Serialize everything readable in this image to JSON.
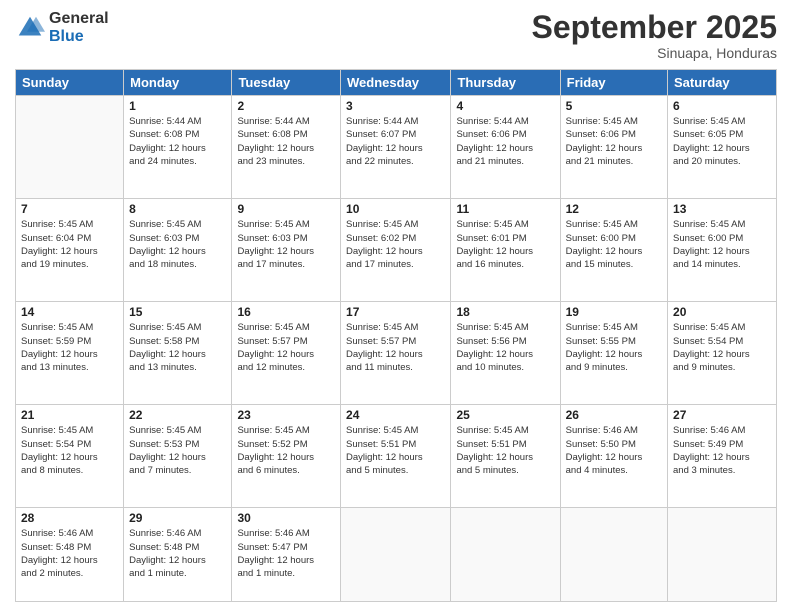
{
  "header": {
    "logo_general": "General",
    "logo_blue": "Blue",
    "month_title": "September 2025",
    "location": "Sinuapa, Honduras"
  },
  "days_of_week": [
    "Sunday",
    "Monday",
    "Tuesday",
    "Wednesday",
    "Thursday",
    "Friday",
    "Saturday"
  ],
  "weeks": [
    [
      {
        "day": "",
        "info": ""
      },
      {
        "day": "1",
        "info": "Sunrise: 5:44 AM\nSunset: 6:08 PM\nDaylight: 12 hours\nand 24 minutes."
      },
      {
        "day": "2",
        "info": "Sunrise: 5:44 AM\nSunset: 6:08 PM\nDaylight: 12 hours\nand 23 minutes."
      },
      {
        "day": "3",
        "info": "Sunrise: 5:44 AM\nSunset: 6:07 PM\nDaylight: 12 hours\nand 22 minutes."
      },
      {
        "day": "4",
        "info": "Sunrise: 5:44 AM\nSunset: 6:06 PM\nDaylight: 12 hours\nand 21 minutes."
      },
      {
        "day": "5",
        "info": "Sunrise: 5:45 AM\nSunset: 6:06 PM\nDaylight: 12 hours\nand 21 minutes."
      },
      {
        "day": "6",
        "info": "Sunrise: 5:45 AM\nSunset: 6:05 PM\nDaylight: 12 hours\nand 20 minutes."
      }
    ],
    [
      {
        "day": "7",
        "info": "Sunrise: 5:45 AM\nSunset: 6:04 PM\nDaylight: 12 hours\nand 19 minutes."
      },
      {
        "day": "8",
        "info": "Sunrise: 5:45 AM\nSunset: 6:03 PM\nDaylight: 12 hours\nand 18 minutes."
      },
      {
        "day": "9",
        "info": "Sunrise: 5:45 AM\nSunset: 6:03 PM\nDaylight: 12 hours\nand 17 minutes."
      },
      {
        "day": "10",
        "info": "Sunrise: 5:45 AM\nSunset: 6:02 PM\nDaylight: 12 hours\nand 17 minutes."
      },
      {
        "day": "11",
        "info": "Sunrise: 5:45 AM\nSunset: 6:01 PM\nDaylight: 12 hours\nand 16 minutes."
      },
      {
        "day": "12",
        "info": "Sunrise: 5:45 AM\nSunset: 6:00 PM\nDaylight: 12 hours\nand 15 minutes."
      },
      {
        "day": "13",
        "info": "Sunrise: 5:45 AM\nSunset: 6:00 PM\nDaylight: 12 hours\nand 14 minutes."
      }
    ],
    [
      {
        "day": "14",
        "info": "Sunrise: 5:45 AM\nSunset: 5:59 PM\nDaylight: 12 hours\nand 13 minutes."
      },
      {
        "day": "15",
        "info": "Sunrise: 5:45 AM\nSunset: 5:58 PM\nDaylight: 12 hours\nand 13 minutes."
      },
      {
        "day": "16",
        "info": "Sunrise: 5:45 AM\nSunset: 5:57 PM\nDaylight: 12 hours\nand 12 minutes."
      },
      {
        "day": "17",
        "info": "Sunrise: 5:45 AM\nSunset: 5:57 PM\nDaylight: 12 hours\nand 11 minutes."
      },
      {
        "day": "18",
        "info": "Sunrise: 5:45 AM\nSunset: 5:56 PM\nDaylight: 12 hours\nand 10 minutes."
      },
      {
        "day": "19",
        "info": "Sunrise: 5:45 AM\nSunset: 5:55 PM\nDaylight: 12 hours\nand 9 minutes."
      },
      {
        "day": "20",
        "info": "Sunrise: 5:45 AM\nSunset: 5:54 PM\nDaylight: 12 hours\nand 9 minutes."
      }
    ],
    [
      {
        "day": "21",
        "info": "Sunrise: 5:45 AM\nSunset: 5:54 PM\nDaylight: 12 hours\nand 8 minutes."
      },
      {
        "day": "22",
        "info": "Sunrise: 5:45 AM\nSunset: 5:53 PM\nDaylight: 12 hours\nand 7 minutes."
      },
      {
        "day": "23",
        "info": "Sunrise: 5:45 AM\nSunset: 5:52 PM\nDaylight: 12 hours\nand 6 minutes."
      },
      {
        "day": "24",
        "info": "Sunrise: 5:45 AM\nSunset: 5:51 PM\nDaylight: 12 hours\nand 5 minutes."
      },
      {
        "day": "25",
        "info": "Sunrise: 5:45 AM\nSunset: 5:51 PM\nDaylight: 12 hours\nand 5 minutes."
      },
      {
        "day": "26",
        "info": "Sunrise: 5:46 AM\nSunset: 5:50 PM\nDaylight: 12 hours\nand 4 minutes."
      },
      {
        "day": "27",
        "info": "Sunrise: 5:46 AM\nSunset: 5:49 PM\nDaylight: 12 hours\nand 3 minutes."
      }
    ],
    [
      {
        "day": "28",
        "info": "Sunrise: 5:46 AM\nSunset: 5:48 PM\nDaylight: 12 hours\nand 2 minutes."
      },
      {
        "day": "29",
        "info": "Sunrise: 5:46 AM\nSunset: 5:48 PM\nDaylight: 12 hours\nand 1 minute."
      },
      {
        "day": "30",
        "info": "Sunrise: 5:46 AM\nSunset: 5:47 PM\nDaylight: 12 hours\nand 1 minute."
      },
      {
        "day": "",
        "info": ""
      },
      {
        "day": "",
        "info": ""
      },
      {
        "day": "",
        "info": ""
      },
      {
        "day": "",
        "info": ""
      }
    ]
  ]
}
